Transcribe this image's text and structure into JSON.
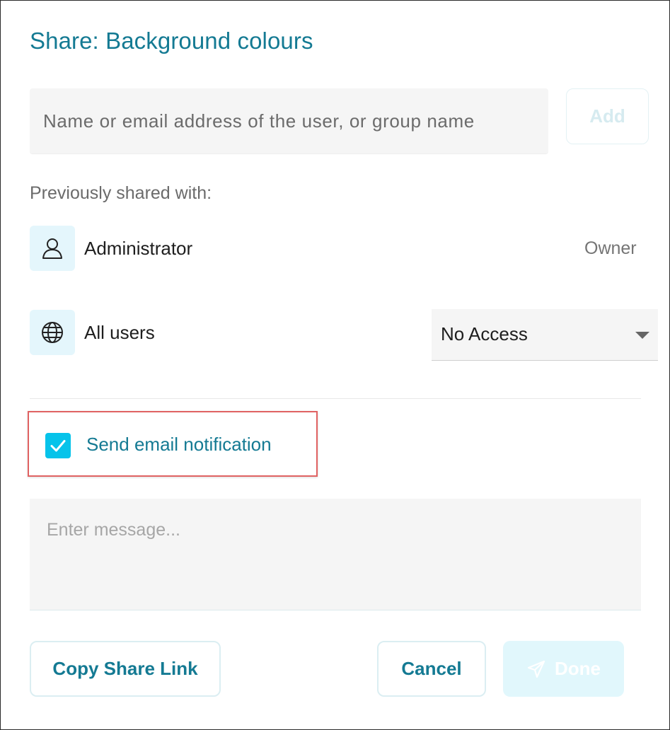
{
  "dialog": {
    "title": "Share: Background colours"
  },
  "search": {
    "placeholder": "Name or email address of the user, or group name",
    "value": "",
    "add_label": "Add"
  },
  "shared": {
    "label": "Previously shared with:",
    "entries": [
      {
        "name": "Administrator",
        "icon": "user-icon",
        "role": "Owner"
      },
      {
        "name": "All users",
        "icon": "globe-icon",
        "access": "No Access"
      }
    ]
  },
  "notification": {
    "label": "Send email notification",
    "checked": true
  },
  "message": {
    "placeholder": "Enter message...",
    "value": ""
  },
  "actions": {
    "copy_link_label": "Copy Share Link",
    "cancel_label": "Cancel",
    "done_label": "Done"
  },
  "colors": {
    "accent": "#147a93",
    "checkbox": "#06c3ea",
    "icon_bg": "#e4f6fc",
    "highlight": "#e06262"
  }
}
